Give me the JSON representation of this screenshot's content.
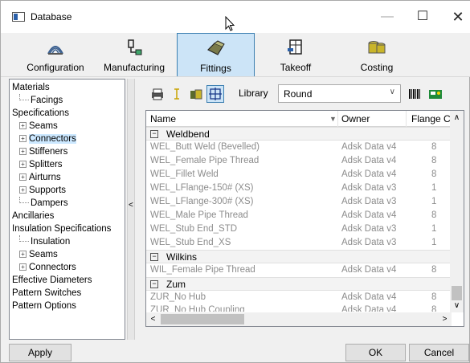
{
  "window": {
    "title": "Database",
    "minimize_icon": "minimize-icon",
    "maximize_icon": "maximize-icon",
    "close_icon": "close-icon"
  },
  "ribbon": {
    "buttons": [
      {
        "label": "Configuration",
        "icon": "configuration-icon"
      },
      {
        "label": "Manufacturing",
        "icon": "manufacturing-icon"
      },
      {
        "label": "Fittings",
        "icon": "fittings-icon",
        "active": true
      },
      {
        "label": "Takeoff",
        "icon": "takeoff-icon"
      },
      {
        "label": "Costing",
        "icon": "costing-icon"
      }
    ]
  },
  "tree": {
    "items": [
      {
        "label": "Materials"
      },
      {
        "label": "Facings"
      },
      {
        "label": "Specifications"
      },
      {
        "label": "Seams",
        "expander": "+"
      },
      {
        "label": "Connectors",
        "expander": "+",
        "selected": true
      },
      {
        "label": "Stiffeners",
        "expander": "+"
      },
      {
        "label": "Splitters",
        "expander": "+"
      },
      {
        "label": "Airturns",
        "expander": "+"
      },
      {
        "label": "Supports",
        "expander": "+"
      },
      {
        "label": "Dampers"
      },
      {
        "label": "Ancillaries"
      },
      {
        "label": "Insulation Specifications"
      },
      {
        "label": "Insulation"
      },
      {
        "label": "Seams",
        "expander": "+"
      },
      {
        "label": "Connectors",
        "expander": "+"
      },
      {
        "label": "Effective Diameters"
      },
      {
        "label": "Pattern Switches"
      },
      {
        "label": "Pattern Options"
      }
    ],
    "collapse_glyph": "<"
  },
  "toolbar": {
    "library_label": "Library",
    "library_value": "Round",
    "icons": [
      "print-icon",
      "text-cursor-icon",
      "database-icon",
      "grid-icon",
      "barcode-icon",
      "image-icon"
    ]
  },
  "grid": {
    "columns": {
      "name": "Name",
      "owner": "Owner",
      "flange": "Flange Co"
    },
    "groups": [
      {
        "name": "Weldbend",
        "rows": [
          {
            "name": "WEL_Butt Weld (Bevelled)",
            "owner": "Adsk Data v4",
            "flange": "8"
          },
          {
            "name": "WEL_Female Pipe Thread",
            "owner": "Adsk Data v4",
            "flange": "8"
          },
          {
            "name": "WEL_Fillet Weld",
            "owner": "Adsk Data v4",
            "flange": "8"
          },
          {
            "name": "WEL_LFlange-150# (XS)",
            "owner": "Adsk Data v3",
            "flange": "1"
          },
          {
            "name": "WEL_LFlange-300# (XS)",
            "owner": "Adsk Data v3",
            "flange": "1"
          },
          {
            "name": "WEL_Male Pipe Thread",
            "owner": "Adsk Data v4",
            "flange": "8"
          },
          {
            "name": "WEL_Stub End_STD",
            "owner": "Adsk Data v3",
            "flange": "1"
          },
          {
            "name": "WEL_Stub End_XS",
            "owner": "Adsk Data v3",
            "flange": "1"
          }
        ]
      },
      {
        "name": "Wilkins",
        "rows": [
          {
            "name": "WIL_Female Pipe Thread",
            "owner": "Adsk Data v4",
            "flange": "8"
          }
        ]
      },
      {
        "name": "Zum",
        "rows": [
          {
            "name": "ZUR_No Hub",
            "owner": "Adsk Data v4",
            "flange": "8"
          },
          {
            "name": "ZUR_No Hub Coupling",
            "owner": "Adsk Data v4",
            "flange": "8"
          }
        ]
      }
    ]
  },
  "buttons": {
    "apply": "Apply",
    "ok": "OK",
    "cancel": "Cancel"
  }
}
